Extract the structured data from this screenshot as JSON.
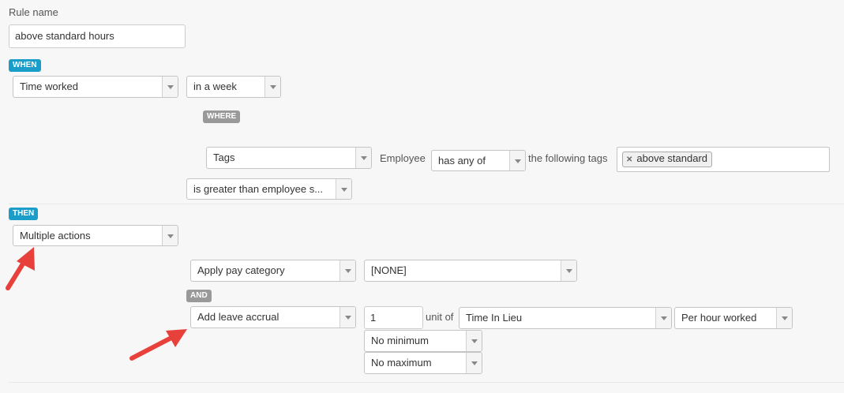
{
  "rule": {
    "name_label": "Rule name",
    "name_value": "above standard hours"
  },
  "when": {
    "badge": "WHEN",
    "metric": "Time worked",
    "period": "in a week",
    "where_badge": "WHERE",
    "filter_type": "Tags",
    "employee_label": "Employee",
    "match_mode": "has any of",
    "tags_label": "the following tags",
    "tags": [
      "above standard"
    ],
    "comparison": "is greater than employee s..."
  },
  "then": {
    "badge": "THEN",
    "action": "Multiple actions",
    "action1": {
      "type": "Apply pay category",
      "value": "[NONE]"
    },
    "and_badge": "AND",
    "action2": {
      "type": "Add leave accrual",
      "quantity": "1",
      "unit_label": "unit of",
      "leave_type": "Time In Lieu",
      "rate": "Per hour worked",
      "minimum": "No minimum",
      "maximum": "No maximum"
    }
  },
  "colors": {
    "badge_primary": "#1a9ec9",
    "badge_secondary": "#999999",
    "annotation_arrow": "#e8413b"
  }
}
